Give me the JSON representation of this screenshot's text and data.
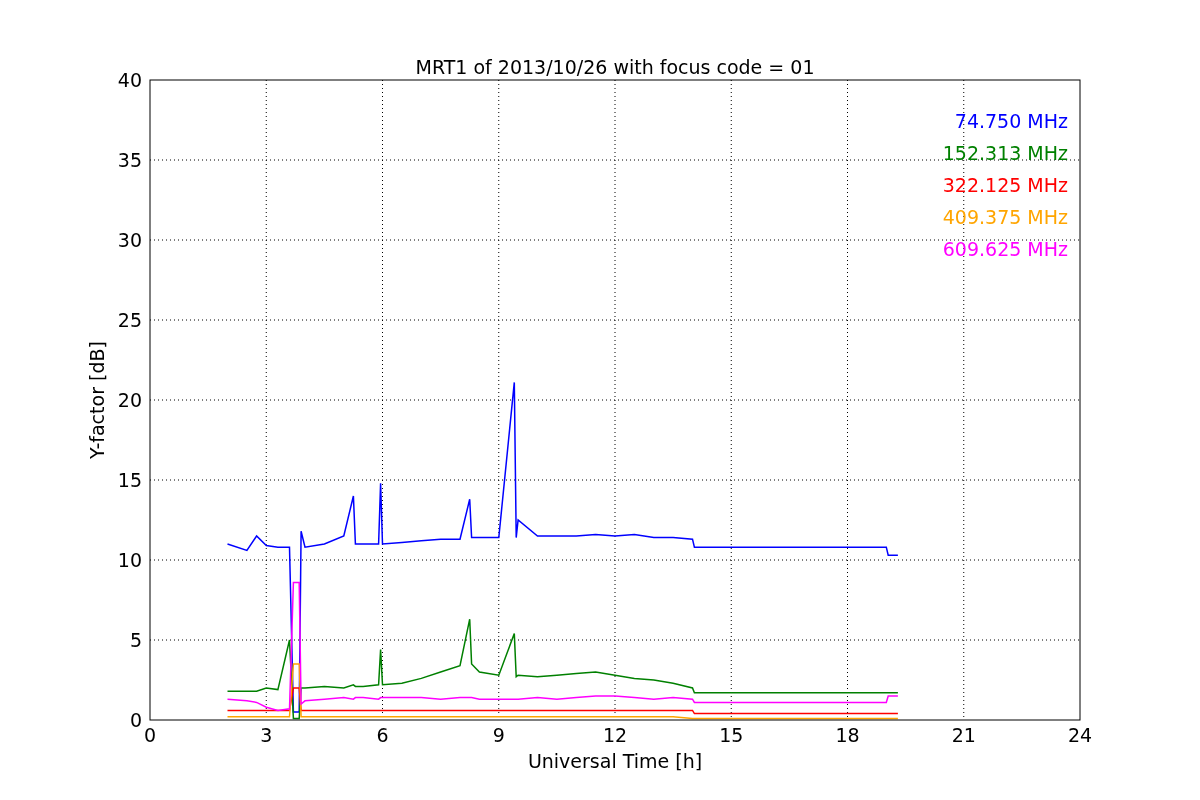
{
  "chart": {
    "chart_data": {
      "type": "line",
      "title": "MRT1 of 2013/10/26 with focus code = 01",
      "xlabel": "Universal Time [h]",
      "ylabel": "Y-factor [dB]",
      "grid": true,
      "x": [
        2.0,
        2.5,
        2.75,
        3.0,
        3.3,
        3.6,
        3.7,
        3.85,
        3.9,
        4.0,
        4.5,
        5.0,
        5.25,
        5.3,
        5.5,
        5.9,
        5.95,
        6.0,
        6.5,
        7,
        7.5,
        8,
        8.25,
        8.3,
        8.5,
        9,
        9.4,
        9.45,
        9.5,
        10,
        10.5,
        11,
        11.5,
        12,
        12.5,
        13,
        13.5,
        14,
        14.05,
        19,
        19.05,
        19.3
      ],
      "series": [
        {
          "name": "74.750 MHz",
          "color": "#0000ff",
          "values": [
            11,
            10.6,
            11.5,
            10.9,
            10.8,
            10.8,
            0.5,
            0.5,
            11.8,
            10.8,
            11.0,
            11.5,
            14,
            11,
            11,
            11,
            14.8,
            11,
            11.1,
            11.2,
            11.3,
            11.3,
            13.8,
            11.4,
            11.4,
            11.4,
            21.1,
            11.4,
            12.5,
            11.5,
            11.5,
            11.5,
            11.6,
            11.5,
            11.6,
            11.4,
            11.4,
            11.3,
            10.8,
            10.8,
            10.3,
            10.3
          ]
        },
        {
          "name": "152.313 MHz",
          "color": "#008000",
          "values": [
            1.8,
            1.8,
            1.8,
            2.0,
            1.9,
            5.0,
            0.1,
            0.1,
            2.0,
            2.0,
            2.1,
            2.0,
            2.2,
            2.1,
            2.1,
            2.2,
            4.4,
            2.2,
            2.3,
            2.6,
            3.0,
            3.4,
            6.3,
            3.5,
            3.0,
            2.8,
            5.4,
            2.7,
            2.8,
            2.7,
            2.8,
            2.9,
            3.0,
            2.8,
            2.6,
            2.5,
            2.3,
            2.0,
            1.7,
            1.7,
            1.7,
            1.7
          ]
        },
        {
          "name": "322.125 MHz",
          "color": "#ff0000",
          "values": [
            0.6,
            0.6,
            0.6,
            0.6,
            0.6,
            0.6,
            2.0,
            2.0,
            0.6,
            0.6,
            0.6,
            0.6,
            0.6,
            0.6,
            0.6,
            0.6,
            0.6,
            0.6,
            0.6,
            0.6,
            0.6,
            0.6,
            0.6,
            0.6,
            0.6,
            0.6,
            0.6,
            0.6,
            0.6,
            0.6,
            0.6,
            0.6,
            0.6,
            0.6,
            0.6,
            0.6,
            0.6,
            0.6,
            0.4,
            0.4,
            0.4,
            0.4
          ]
        },
        {
          "name": "409.375 MHz",
          "color": "#ffa500",
          "values": [
            0.2,
            0.2,
            0.2,
            0.2,
            0.2,
            0.2,
            3.5,
            3.5,
            0.2,
            0.2,
            0.2,
            0.2,
            0.2,
            0.2,
            0.2,
            0.2,
            0.2,
            0.2,
            0.2,
            0.2,
            0.2,
            0.2,
            0.2,
            0.2,
            0.2,
            0.2,
            0.2,
            0.2,
            0.2,
            0.2,
            0.2,
            0.2,
            0.2,
            0.2,
            0.2,
            0.2,
            0.2,
            0.1,
            0.1,
            0.1,
            0.1,
            0.1
          ]
        },
        {
          "name": "609.625 MHz",
          "color": "#ff00ff",
          "values": [
            1.3,
            1.2,
            1.1,
            0.8,
            0.6,
            0.7,
            8.6,
            8.6,
            1.0,
            1.2,
            1.3,
            1.4,
            1.3,
            1.4,
            1.4,
            1.3,
            1.4,
            1.4,
            1.4,
            1.4,
            1.3,
            1.4,
            1.4,
            1.4,
            1.3,
            1.3,
            1.3,
            1.3,
            1.3,
            1.4,
            1.3,
            1.4,
            1.5,
            1.5,
            1.4,
            1.3,
            1.4,
            1.3,
            1.1,
            1.1,
            1.5,
            1.5
          ]
        }
      ],
      "xlim": [
        0,
        24
      ],
      "ylim": [
        0,
        40
      ],
      "xticks": [
        0,
        3,
        6,
        9,
        12,
        15,
        18,
        21,
        24
      ],
      "yticks": [
        0,
        5,
        10,
        15,
        20,
        25,
        30,
        35,
        40
      ]
    }
  }
}
